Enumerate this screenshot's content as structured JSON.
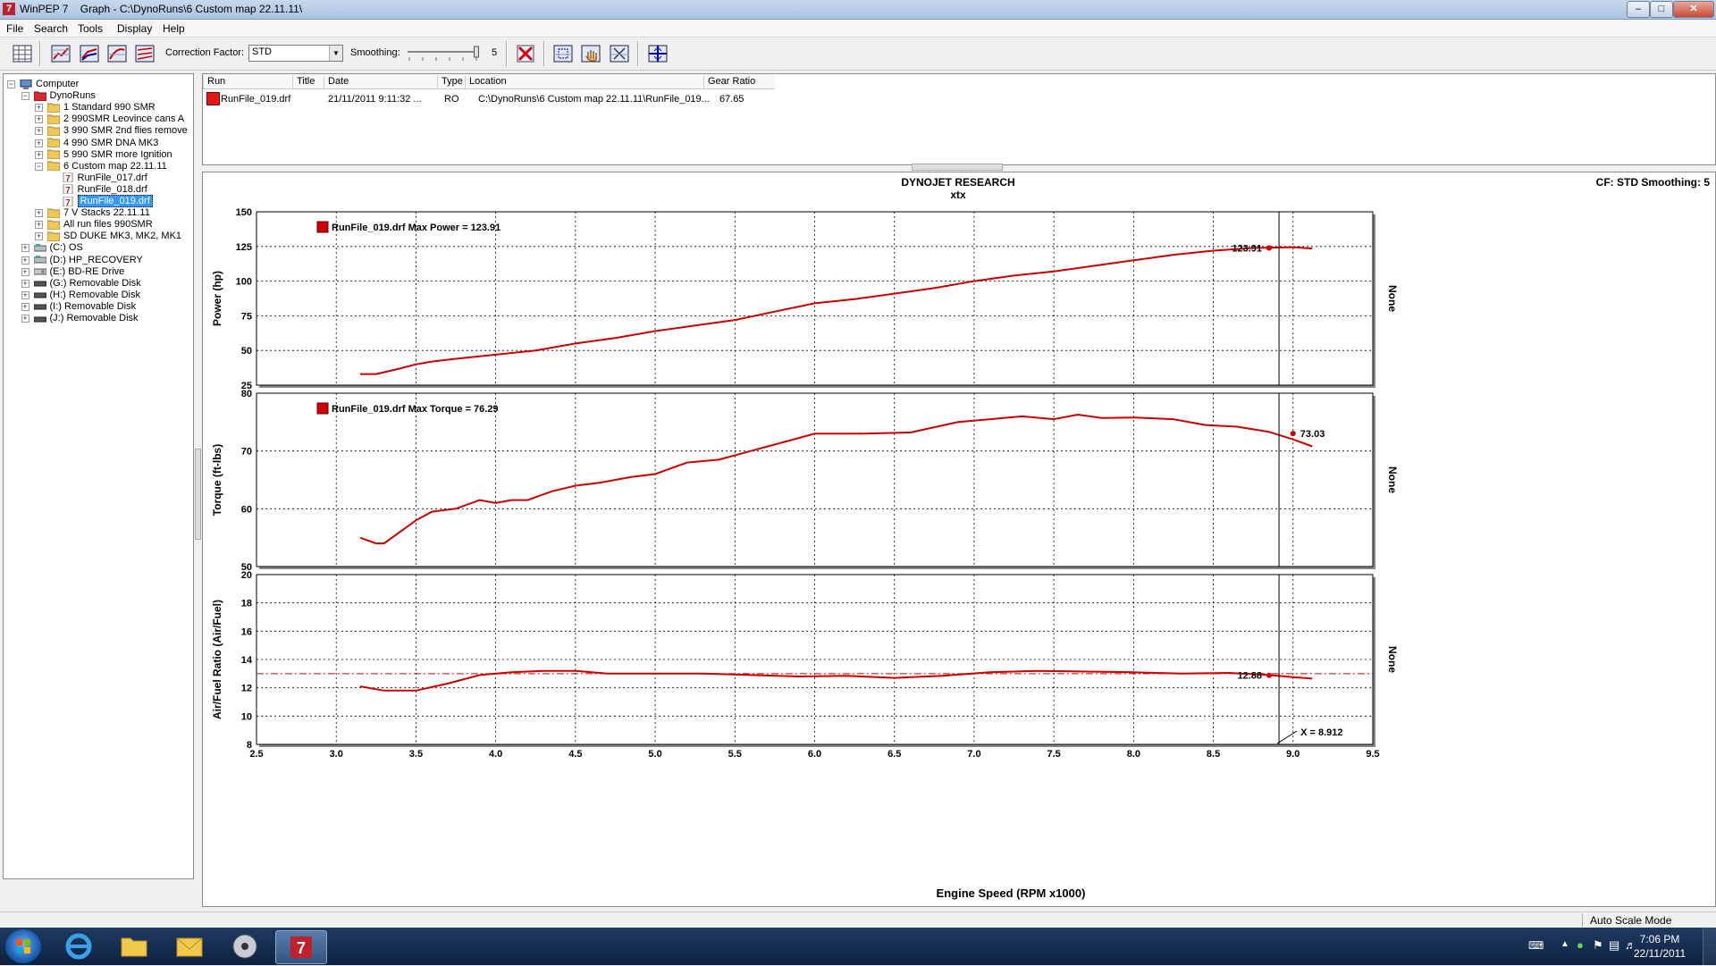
{
  "window": {
    "title": "WinPEP 7    Graph - C:\\DynoRuns\\6 Custom map 22.11.11\\"
  },
  "menu": [
    "File",
    "Search",
    "Tools",
    "Display",
    "Help"
  ],
  "toolbar": {
    "correction_factor_label": "Correction Factor:",
    "correction_factor_value": "STD",
    "smoothing_label": "Smoothing:",
    "smoothing_value": "5",
    "smoothing_level": 5
  },
  "tree": [
    {
      "label": "Computer",
      "level": 0,
      "icon": "computer-icon",
      "expander": "-"
    },
    {
      "label": "DynoRuns",
      "level": 1,
      "icon": "red-folder-icon",
      "expander": "-"
    },
    {
      "label": "1 Standard 990 SMR",
      "level": 2,
      "icon": "folder-icon",
      "expander": "+"
    },
    {
      "label": "2 990SMR Leovince cans A",
      "level": 2,
      "icon": "folder-icon",
      "expander": "+"
    },
    {
      "label": "3 990 SMR 2nd flies remove",
      "level": 2,
      "icon": "folder-icon",
      "expander": "+"
    },
    {
      "label": "4 990 SMR DNA MK3",
      "level": 2,
      "icon": "folder-icon",
      "expander": "+"
    },
    {
      "label": "5 990 SMR more Ignition",
      "level": 2,
      "icon": "folder-icon",
      "expander": "+"
    },
    {
      "label": "6 Custom map 22.11.11",
      "level": 2,
      "icon": "folder-icon",
      "expander": "-"
    },
    {
      "label": "RunFile_017.drf",
      "level": 3,
      "icon": "dynojet-file-icon",
      "expander": ""
    },
    {
      "label": "RunFile_018.drf",
      "level": 3,
      "icon": "dynojet-file-icon",
      "expander": ""
    },
    {
      "label": "RunFile_019.drf",
      "level": 3,
      "icon": "dynojet-file-icon",
      "expander": "",
      "selected": true
    },
    {
      "label": "7 V Stacks 22.11.11",
      "level": 2,
      "icon": "folder-icon",
      "expander": "+"
    },
    {
      "label": "All run files 990SMR",
      "level": 2,
      "icon": "folder-icon",
      "expander": "+"
    },
    {
      "label": "SD DUKE MK3, MK2, MK1",
      "level": 2,
      "icon": "folder-icon",
      "expander": "+"
    },
    {
      "label": "(C:)  OS",
      "level": 1,
      "icon": "drive-icon",
      "expander": "+"
    },
    {
      "label": "(D:)  HP_RECOVERY",
      "level": 1,
      "icon": "drive-icon",
      "expander": "+"
    },
    {
      "label": "(E:)  BD-RE Drive",
      "level": 1,
      "icon": "optical-drive-icon",
      "expander": "+"
    },
    {
      "label": "(G:)  Removable Disk",
      "level": 1,
      "icon": "removable-disk-icon",
      "expander": "+"
    },
    {
      "label": "(H:)  Removable Disk",
      "level": 1,
      "icon": "removable-disk-icon",
      "expander": "+"
    },
    {
      "label": "(I:)  Removable Disk",
      "level": 1,
      "icon": "removable-disk-icon",
      "expander": "+"
    },
    {
      "label": "(J:)  Removable Disk",
      "level": 1,
      "icon": "removable-disk-icon",
      "expander": "+"
    }
  ],
  "runs_table": {
    "headers": [
      "Run",
      "Title",
      "Date",
      "Type",
      "Location",
      "Gear Ratio"
    ],
    "rows": [
      {
        "run": "RunFile_019.drf",
        "title": "",
        "date": "21/11/2011 9:11:32 ...",
        "type": "RO",
        "location": "C:\\DynoRuns\\6 Custom map 22.11.11\\RunFile_019...",
        "gear_ratio": "67.65",
        "color": "#e01818"
      }
    ]
  },
  "graph": {
    "header": "DYNOJET RESEARCH",
    "subheader": "xtx",
    "cf_info": "CF: STD  Smoothing: 5",
    "line_color": "#cc0000"
  },
  "chart_data": {
    "type": "line",
    "xlabel": "Engine Speed (RPM x1000)",
    "xlim": [
      2.5,
      9.5
    ],
    "x_ticks": [
      "2.5",
      "3.0",
      "3.5",
      "4.0",
      "4.5",
      "5.0",
      "5.5",
      "6.0",
      "6.5",
      "7.0",
      "7.5",
      "8.0",
      "8.5",
      "9.0",
      "9.5"
    ],
    "cursor_x": 8.912,
    "cursor_label": "X = 8.912",
    "right_axis_label": "None",
    "grid": true,
    "panels": [
      {
        "name": "power",
        "ylabel": "Power (hp)",
        "ylim": [
          25,
          150
        ],
        "y_ticks": [
          "150",
          "125",
          "100",
          "75",
          "50",
          "25"
        ],
        "legend": "RunFile_019.drf Max Power = 123.91",
        "cursor_value": "123.91",
        "series": [
          {
            "name": "RunFile_019.drf",
            "x": [
              3.15,
              3.25,
              3.4,
              3.5,
              3.6,
              3.75,
              4.0,
              4.25,
              4.5,
              4.75,
              5.0,
              5.25,
              5.5,
              5.75,
              6.0,
              6.25,
              6.5,
              6.75,
              7.0,
              7.25,
              7.5,
              7.75,
              8.0,
              8.25,
              8.5,
              8.75,
              9.0,
              9.12
            ],
            "y": [
              33,
              33,
              37,
              40,
              42,
              44,
              47,
              50,
              55,
              59,
              64,
              68,
              72,
              78,
              84,
              87,
              91,
              95,
              100,
              104,
              107,
              111,
              115,
              119,
              122,
              123.9,
              124.5,
              123.5
            ]
          }
        ]
      },
      {
        "name": "torque",
        "ylabel": "Torque (ft-lbs)",
        "ylim": [
          50,
          80
        ],
        "y_ticks": [
          "80",
          "70",
          "60",
          "50"
        ],
        "legend": "RunFile_019.drf Max Torque = 76.29",
        "cursor_value": "73.03",
        "series": [
          {
            "name": "RunFile_019.drf",
            "x": [
              3.15,
              3.25,
              3.3,
              3.4,
              3.5,
              3.6,
              3.75,
              3.9,
              4.0,
              4.1,
              4.2,
              4.35,
              4.5,
              4.65,
              4.85,
              5.0,
              5.2,
              5.4,
              5.6,
              5.8,
              6.0,
              6.3,
              6.6,
              6.9,
              7.1,
              7.3,
              7.5,
              7.65,
              7.8,
              8.0,
              8.25,
              8.45,
              8.65,
              8.85,
              9.0,
              9.12
            ],
            "y": [
              55,
              54,
              54,
              56,
              58,
              59.5,
              60,
              61.5,
              61,
              61.5,
              61.5,
              63,
              64,
              64.5,
              65.5,
              66,
              68,
              68.5,
              70,
              71.5,
              73,
              73,
              73.2,
              75,
              75.5,
              76,
              75.5,
              76.29,
              75.7,
              75.8,
              75.5,
              74.5,
              74.2,
              73.3,
              72,
              70.8
            ]
          }
        ]
      },
      {
        "name": "afr",
        "ylabel": "Air/Fuel Ratio (Air/Fuel)",
        "ylim": [
          8,
          20
        ],
        "y_ticks": [
          "20",
          "18",
          "16",
          "14",
          "12",
          "10",
          "8"
        ],
        "reference_line": 13.0,
        "cursor_value": "12.88",
        "series": [
          {
            "name": "RunFile_019.drf",
            "x": [
              3.15,
              3.3,
              3.5,
              3.7,
              3.9,
              4.1,
              4.3,
              4.5,
              4.7,
              5.0,
              5.3,
              5.6,
              5.9,
              6.2,
              6.5,
              6.8,
              7.1,
              7.4,
              7.7,
              8.0,
              8.3,
              8.6,
              8.85,
              9.0,
              9.12
            ],
            "y": [
              12.1,
              11.8,
              11.8,
              12.3,
              12.9,
              13.1,
              13.2,
              13.2,
              13.0,
              13.0,
              13.0,
              12.9,
              12.8,
              12.85,
              12.7,
              12.85,
              13.1,
              13.2,
              13.15,
              13.1,
              13.0,
              13.05,
              12.9,
              12.75,
              12.65
            ]
          }
        ]
      }
    ]
  },
  "status": {
    "mode": "Auto Scale Mode"
  },
  "taskbar": {
    "clock_time": "7:06 PM",
    "clock_date": "22/11/2011",
    "items": [
      "internet-explorer-icon",
      "file-explorer-icon",
      "outlook-icon",
      "disc-burner-icon",
      "winpep-icon"
    ]
  }
}
